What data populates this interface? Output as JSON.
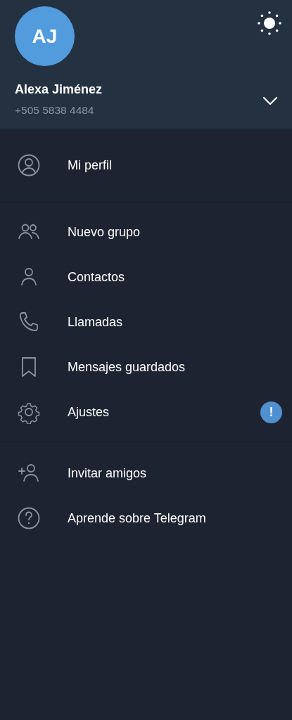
{
  "header": {
    "avatar_initials": "AJ",
    "name": "Alexa Jiménez",
    "phone": "+505 5838 4484"
  },
  "sections": [
    {
      "items": [
        {
          "label": "Mi perfil"
        }
      ]
    },
    {
      "items": [
        {
          "label": "Nuevo grupo"
        },
        {
          "label": "Contactos"
        },
        {
          "label": "Llamadas"
        },
        {
          "label": "Mensajes guardados"
        },
        {
          "label": "Ajustes",
          "badge": "!"
        }
      ]
    },
    {
      "items": [
        {
          "label": "Invitar amigos"
        },
        {
          "label": "Aprende sobre Telegram"
        }
      ]
    }
  ]
}
